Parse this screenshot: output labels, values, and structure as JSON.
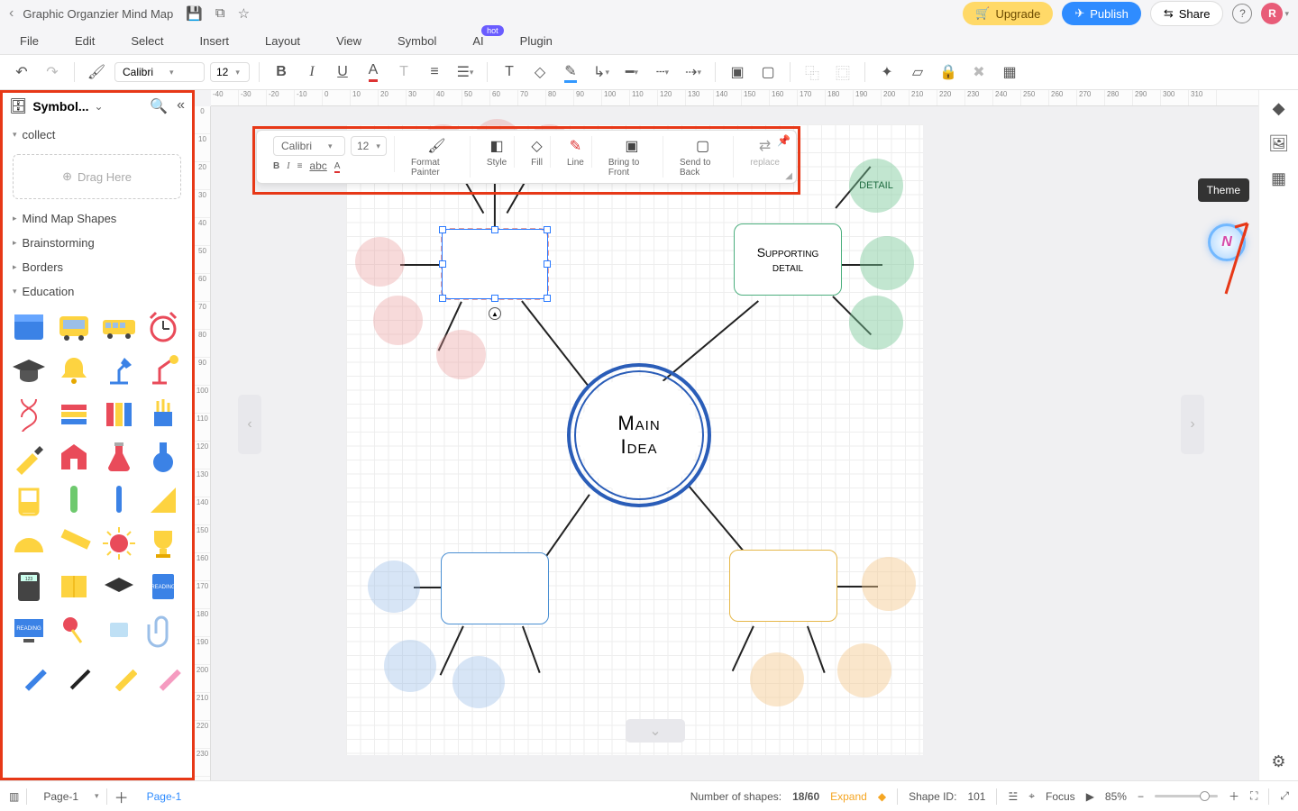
{
  "titlebar": {
    "title": "Graphic Organzier Mind Map"
  },
  "actions": {
    "upgrade": "Upgrade",
    "publish": "Publish",
    "share": "Share",
    "avatar": "R"
  },
  "menubar": [
    "File",
    "Edit",
    "Select",
    "Insert",
    "Layout",
    "View",
    "Symbol",
    "AI",
    "Plugin"
  ],
  "menubar_badge": "hot",
  "toolbar": {
    "font": "Calibri",
    "size": "12"
  },
  "minitoolbar": {
    "font": "Calibri",
    "size": "12",
    "format_painter": "Format Painter",
    "style": "Style",
    "fill": "Fill",
    "line": "Line",
    "bring_front": "Bring to Front",
    "send_back": "Send to Back",
    "replace": "replace"
  },
  "sidebar": {
    "title": "Symbol...",
    "groups": {
      "collect": "collect",
      "drag_here": "Drag Here",
      "mindmap": "Mind Map Shapes",
      "brainstorm": "Brainstorming",
      "borders": "Borders",
      "education": "Education"
    }
  },
  "ruler_h": [
    "-40",
    "-30",
    "-20",
    "-10",
    "0",
    "10",
    "20",
    "30",
    "40",
    "50",
    "60",
    "70",
    "80",
    "90",
    "100",
    "110",
    "120",
    "130",
    "140",
    "150",
    "160",
    "170",
    "180",
    "190",
    "200",
    "210",
    "220",
    "230",
    "240",
    "250",
    "260",
    "270",
    "280",
    "290",
    "300",
    "310"
  ],
  "ruler_v": [
    "0",
    "10",
    "20",
    "30",
    "40",
    "50",
    "60",
    "70",
    "80",
    "90",
    "100",
    "110",
    "120",
    "130",
    "140",
    "150",
    "160",
    "170",
    "180",
    "190",
    "200",
    "210",
    "220",
    "230"
  ],
  "mindmap": {
    "main1": "Main",
    "main2": "Idea",
    "supporting1": "Supporting",
    "supporting2": "detail",
    "detail": "DETAIL"
  },
  "tooltip": {
    "theme": "Theme"
  },
  "bottombar": {
    "page_tab": "Page-1",
    "page_active": "Page-1",
    "shapes_label": "Number of shapes:",
    "shapes_value": "18/60",
    "expand": "Expand",
    "shape_id_label": "Shape ID:",
    "shape_id_value": "101",
    "focus": "Focus",
    "zoom": "85%"
  }
}
